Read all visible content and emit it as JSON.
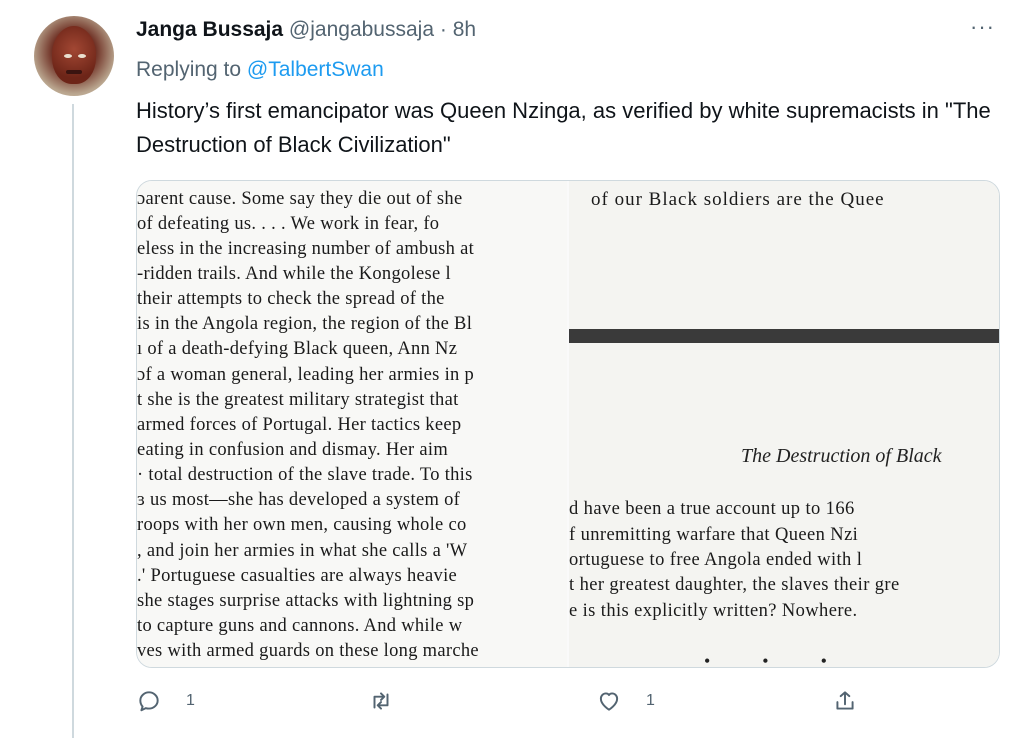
{
  "tweet": {
    "name": "Janga Bussaja",
    "handle": "@jangabussaja",
    "separator": "·",
    "time": "8h",
    "more": "···",
    "replying_prefix": "Replying to ",
    "replying_to": "@TalbertSwan",
    "text": "History’s first emancipator was Queen Nzinga, as verified by white supremacists in \"The Destruction of Black Civilization\""
  },
  "media": {
    "left_page_lines": [
      "ɔarent cause. Some say they die out of she",
      "  of defeating us. . . . We work in fear, fo",
      "eless in the increasing number of ambush at",
      "-ridden trails. And while the Kongolese l",
      "  their attempts to check the spread of the",
      "is in the Angola region, the region of the Bl",
      "ı of a death-defying Black queen, Ann Nz",
      "ɔf a woman general, leading her armies in p",
      "t she is the greatest military strategist that",
      "  armed forces of Portugal. Her tactics keep",
      "eating in confusion and dismay. Her aim",
      "· total destruction of the slave trade. To this",
      "ɜ us most—she has developed a system of",
      "roops with her own men, causing whole co",
      ", and join her armies in what she calls a 'W",
      ".' Portuguese casualties are always heavie",
      "she stages surprise attacks with lightning sp",
      "  to capture guns and cannons. And while w",
      "ves with armed guards on these long marche"
    ],
    "right_top_line": "of our Black soldiers are the Quee",
    "right_heading": "The Destruction of Black",
    "right_lines": [
      "d have been a true account up to 166",
      "f unremitting warfare that Queen Nzi",
      "ortuguese to free Angola ended with l",
      "t her greatest daughter, the slaves their gre",
      "e is this explicitly written? Nowhere."
    ],
    "dots": "•••"
  },
  "actions": {
    "reply_count": "1",
    "retweet_count": "",
    "like_count": "1"
  }
}
